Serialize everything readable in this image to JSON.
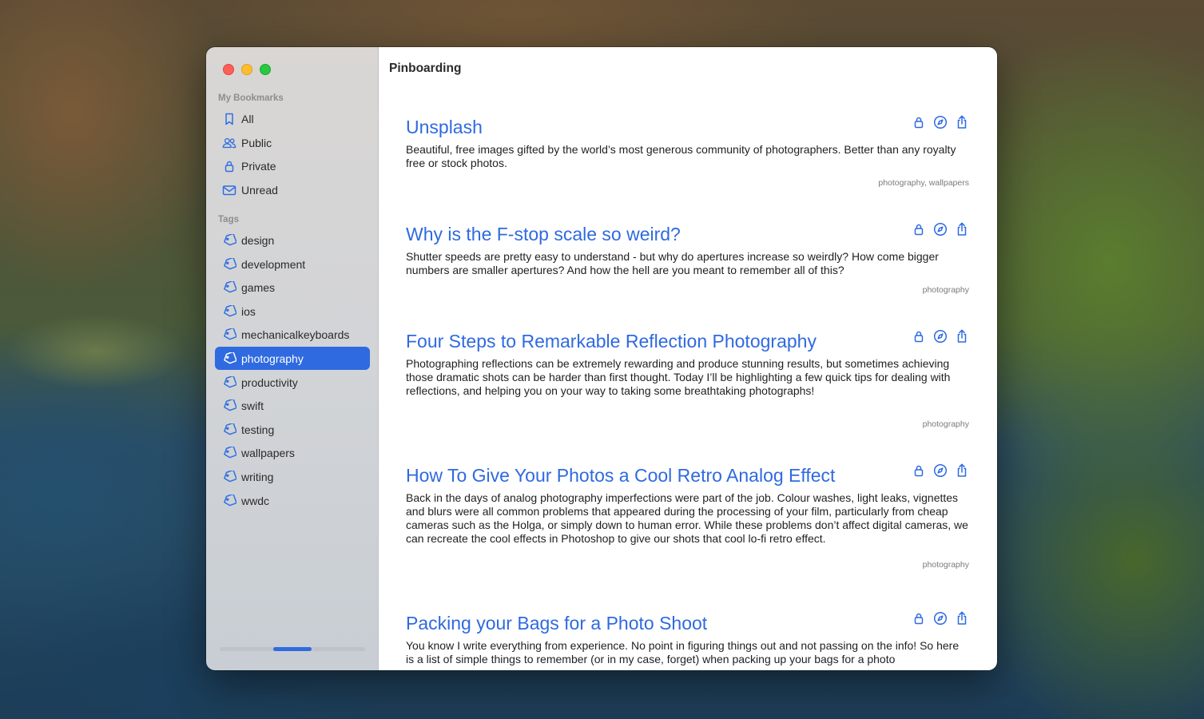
{
  "window": {
    "title": "Pinboarding"
  },
  "sidebar": {
    "bookmarks_header": "My Bookmarks",
    "bookmarks": [
      {
        "label": "All",
        "icon": "bookmark-icon"
      },
      {
        "label": "Public",
        "icon": "people-icon"
      },
      {
        "label": "Private",
        "icon": "lock-icon"
      },
      {
        "label": "Unread",
        "icon": "envelope-icon"
      }
    ],
    "tags_header": "Tags",
    "tags": [
      {
        "label": "design",
        "icon": "tag-icon"
      },
      {
        "label": "development",
        "icon": "tag-icon"
      },
      {
        "label": "games",
        "icon": "tag-icon"
      },
      {
        "label": "ios",
        "icon": "tag-icon"
      },
      {
        "label": "mechanicalkeyboards",
        "icon": "tag-icon"
      },
      {
        "label": "photography",
        "icon": "tag-icon",
        "selected": true
      },
      {
        "label": "productivity",
        "icon": "tag-icon"
      },
      {
        "label": "swift",
        "icon": "tag-icon"
      },
      {
        "label": "testing",
        "icon": "tag-icon"
      },
      {
        "label": "wallpapers",
        "icon": "tag-icon"
      },
      {
        "label": "writing",
        "icon": "tag-icon"
      },
      {
        "label": "wwdc",
        "icon": "tag-icon"
      }
    ],
    "scroll_position": 0.5
  },
  "bookmarks": [
    {
      "title": "Unsplash",
      "description": "Beautiful, free images gifted by the world’s most generous community of photographers. Better than any royalty free or stock photos.",
      "tags": "photography, wallpapers"
    },
    {
      "title": "Why is the F-stop scale so weird?",
      "description": "Shutter speeds are pretty easy to understand - but why do apertures increase so weirdly? How come bigger numbers are smaller apertures? And how the hell are you meant to remember all of this?",
      "tags": "photography"
    },
    {
      "title": "Four Steps to Remarkable Reflection Photography",
      "description": "Photographing reflections can be extremely rewarding and produce stunning results, but sometimes achieving those dramatic shots can be harder than first thought. Today I’ll be highlighting a few quick tips for dealing with reflections, and helping you on your way to taking some breathtaking photographs!",
      "tags": "photography"
    },
    {
      "title": "How To Give Your Photos a Cool Retro Analog Effect",
      "description": "Back in the days of analog photography imperfections were part of the job. Colour washes, light leaks, vignettes and blurs were all common problems that appeared during the processing of your film, particularly from cheap cameras such as the Holga, or simply down to human error. While these problems don’t affect digital cameras, we can recreate the cool effects in Photoshop to give our shots that cool lo-fi retro effect.",
      "tags": "photography"
    },
    {
      "title": "Packing your Bags for a Photo Shoot",
      "description": "You know I write everything from experience. No point in figuring things out and not passing on the info! So here is a list of simple things to remember (or in my case, forget) when packing up your bags for a photo",
      "tags": ""
    }
  ],
  "colors": {
    "accent": "#2f6ae0",
    "selection": "#2f6ae0"
  }
}
